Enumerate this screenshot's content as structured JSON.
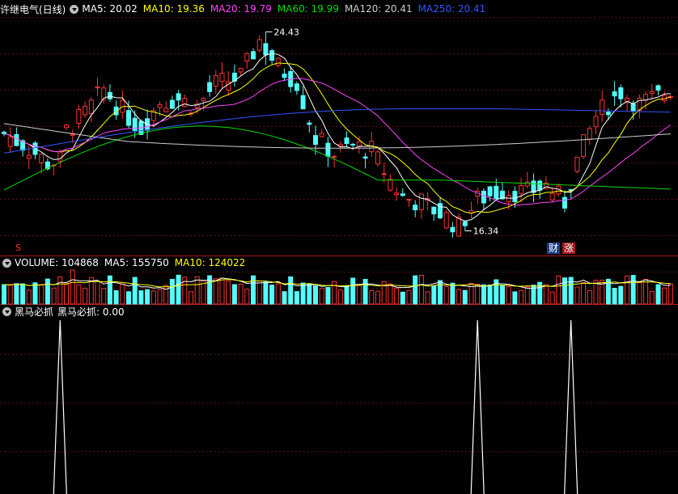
{
  "header": {
    "title": "许继电气(日线)",
    "ma": [
      {
        "label": "MA5: 20.02",
        "color": "#ffffff"
      },
      {
        "label": "MA10: 19.36",
        "color": "#ffff00"
      },
      {
        "label": "MA20: 19.79",
        "color": "#ff44ff"
      },
      {
        "label": "MA60: 19.99",
        "color": "#00dd00"
      },
      {
        "label": "MA120: 20.41",
        "color": "#cccccc"
      },
      {
        "label": "MA250: 20.41",
        "color": "#3355ff"
      }
    ]
  },
  "volume_header": {
    "items": [
      {
        "label": "VOLUME: 104868",
        "color": "#ffffff"
      },
      {
        "label": "MA5: 155750",
        "color": "#ffffff"
      },
      {
        "label": "MA10: 124022",
        "color": "#ffff00"
      }
    ]
  },
  "indicator_header": {
    "name": "黑马必抓",
    "value_label": "黑马必抓: 0.00"
  },
  "annotations": {
    "high": "24.43",
    "low": "16.34",
    "tag_cai": "财",
    "tag_zhang": "涨",
    "marker_s": "S"
  },
  "chart_data": {
    "type": "candlestick",
    "price_range": [
      15.8,
      25.0
    ],
    "high_label": 24.43,
    "low_label": 16.34,
    "moving_averages": [
      "MA5",
      "MA10",
      "MA20",
      "MA60",
      "MA120",
      "MA250"
    ],
    "volume_ma": [
      "MA5",
      "MA10"
    ],
    "indicator_peaks_at_candle_index": [
      9,
      76,
      91
    ],
    "indicator_value": 0.0
  }
}
